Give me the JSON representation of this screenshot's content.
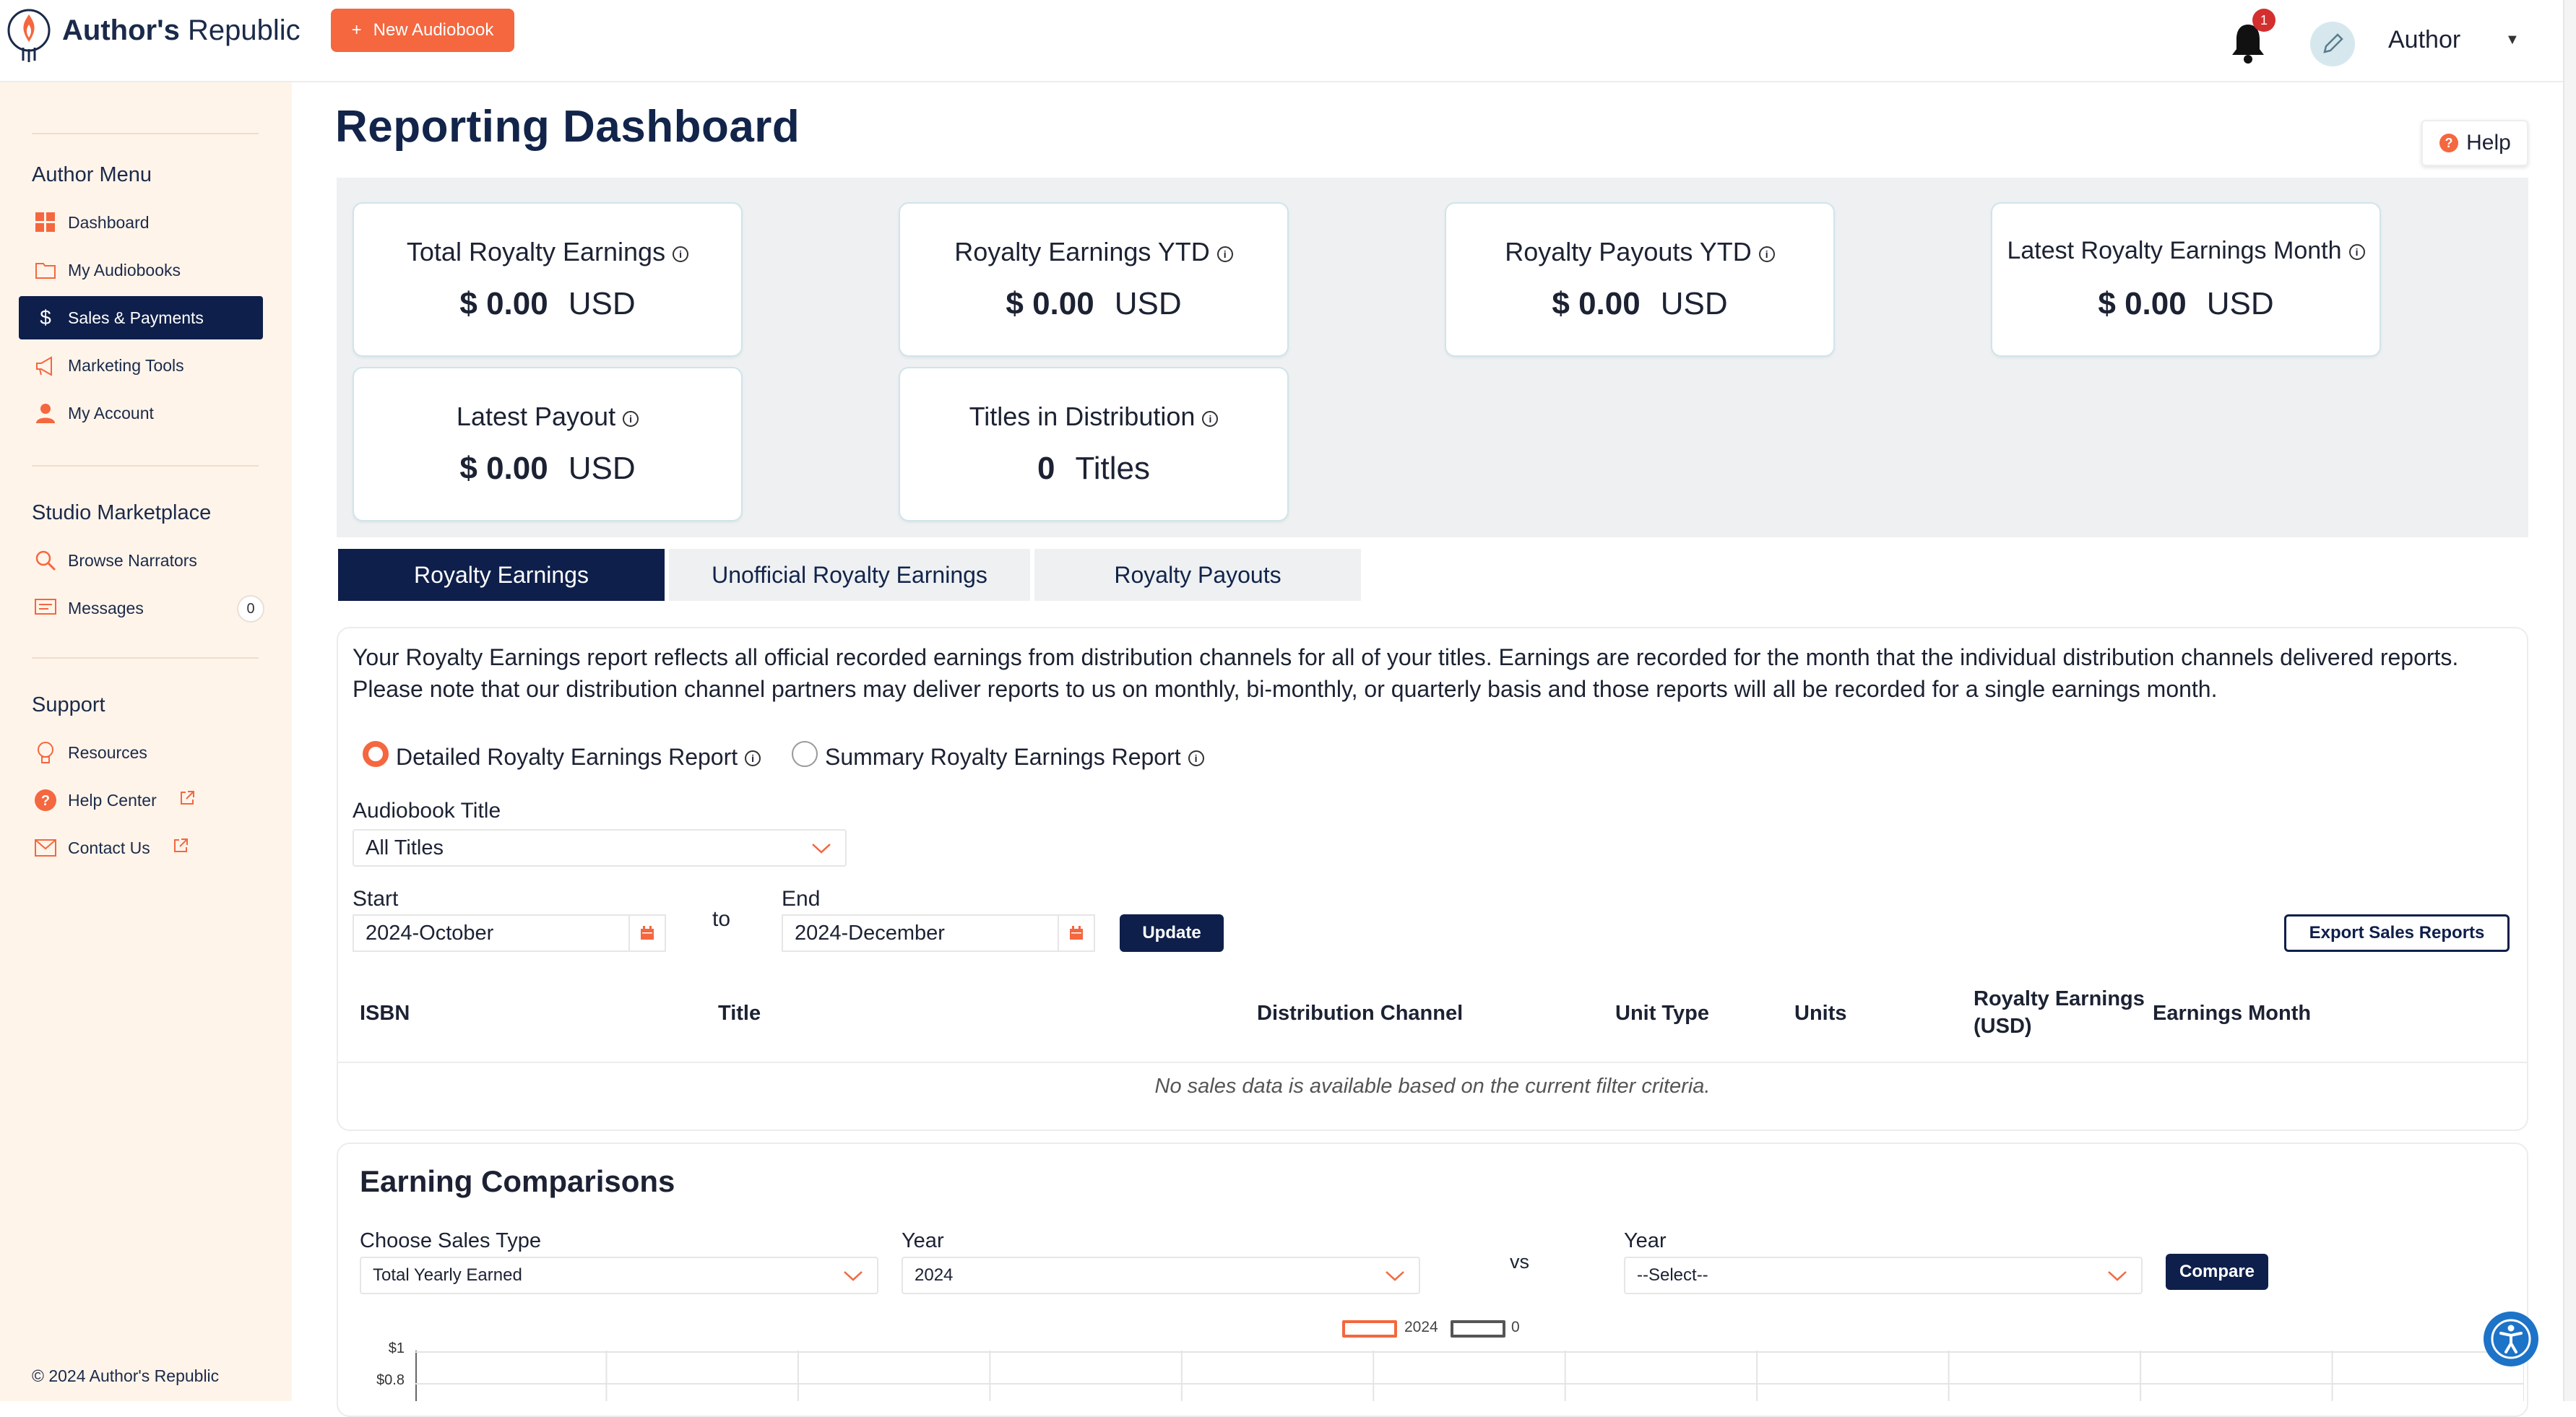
{
  "app": {
    "brand_bold": "Author's",
    "brand_rest": " Republic",
    "new_button": "New Audiobook",
    "notification_count": "1",
    "user_name": "Author",
    "accent_color": "#f4673f",
    "navy_color": "#0f1f4b"
  },
  "sidebar": {
    "author_menu_title": "Author Menu",
    "author_items": [
      {
        "label": "Dashboard",
        "icon": "dashboard-grid-icon"
      },
      {
        "label": "My Audiobooks",
        "icon": "folder-icon"
      },
      {
        "label": "Sales & Payments",
        "icon": "dollar-icon",
        "active": true
      },
      {
        "label": "Marketing Tools",
        "icon": "megaphone-icon"
      },
      {
        "label": "My Account",
        "icon": "user-icon"
      }
    ],
    "studio_title": "Studio Marketplace",
    "studio_items": [
      {
        "label": "Browse Narrators",
        "icon": "search-icon"
      },
      {
        "label": "Messages",
        "icon": "message-icon",
        "count": "0"
      }
    ],
    "support_title": "Support",
    "support_items": [
      {
        "label": "Resources",
        "icon": "lightbulb-icon"
      },
      {
        "label": "Help Center",
        "icon": "question-icon",
        "external": true
      },
      {
        "label": "Contact Us",
        "icon": "envelope-icon",
        "external": true
      }
    ],
    "copyright": "© 2024 Author's Republic"
  },
  "page": {
    "title": "Reporting Dashboard",
    "help_label": "Help"
  },
  "stats": [
    {
      "label": "Total Royalty Earnings",
      "value": "$ 0.00",
      "unit": "USD"
    },
    {
      "label": "Royalty Earnings YTD",
      "value": "$ 0.00",
      "unit": "USD"
    },
    {
      "label": "Royalty Payouts YTD",
      "value": "$ 0.00",
      "unit": "USD"
    },
    {
      "label": "Latest Royalty Earnings Month",
      "value": "$ 0.00",
      "unit": "USD"
    },
    {
      "label": "Latest Payout",
      "value": "$ 0.00",
      "unit": "USD"
    },
    {
      "label": "Titles in Distribution",
      "value": "0",
      "unit": "Titles"
    }
  ],
  "tabs": [
    {
      "label": "Royalty Earnings",
      "active": true
    },
    {
      "label": "Unofficial Royalty Earnings",
      "active": false
    },
    {
      "label": "Royalty Payouts",
      "active": false
    }
  ],
  "report": {
    "description": "Your Royalty Earnings report reflects all official recorded earnings from distribution channels for all of your titles. Earnings are recorded for the month that the individual distribution channels delivered reports. Please note that our distribution channel partners may deliver reports to us on monthly, bi-monthly, or quarterly basis and those reports will all be recorded for a single earnings month.",
    "radio_detailed": "Detailed Royalty Earnings Report",
    "radio_summary": "Summary Royalty Earnings Report",
    "selected_radio": "detailed",
    "title_label": "Audiobook Title",
    "title_value": "All Titles",
    "start_label": "Start",
    "start_value": "2024-October",
    "to_label": "to",
    "end_label": "End",
    "end_value": "2024-December",
    "update_button": "Update",
    "export_button": "Export Sales Reports",
    "columns": [
      "ISBN",
      "Title",
      "Distribution Channel",
      "Unit Type",
      "Units",
      "Royalty Earnings\n(USD)",
      "Earnings Month"
    ],
    "empty_message": "No sales data is available based on the current filter criteria."
  },
  "comparisons": {
    "title": "Earning Comparisons",
    "sales_type_label": "Choose Sales Type",
    "sales_type_value": "Total Yearly Earned",
    "year_label": "Year",
    "year_value": "2024",
    "vs_label": "vs",
    "year2_label": "Year",
    "year2_value": "--Select--",
    "compare_button": "Compare"
  },
  "chart_data": {
    "type": "line",
    "series": [
      {
        "name": "2024",
        "color": "#f4673f",
        "values": []
      },
      {
        "name": "0",
        "color": "#555555",
        "values": []
      }
    ],
    "yticks": [
      "$1",
      "$0.8"
    ],
    "ylim": [
      0,
      1
    ]
  }
}
